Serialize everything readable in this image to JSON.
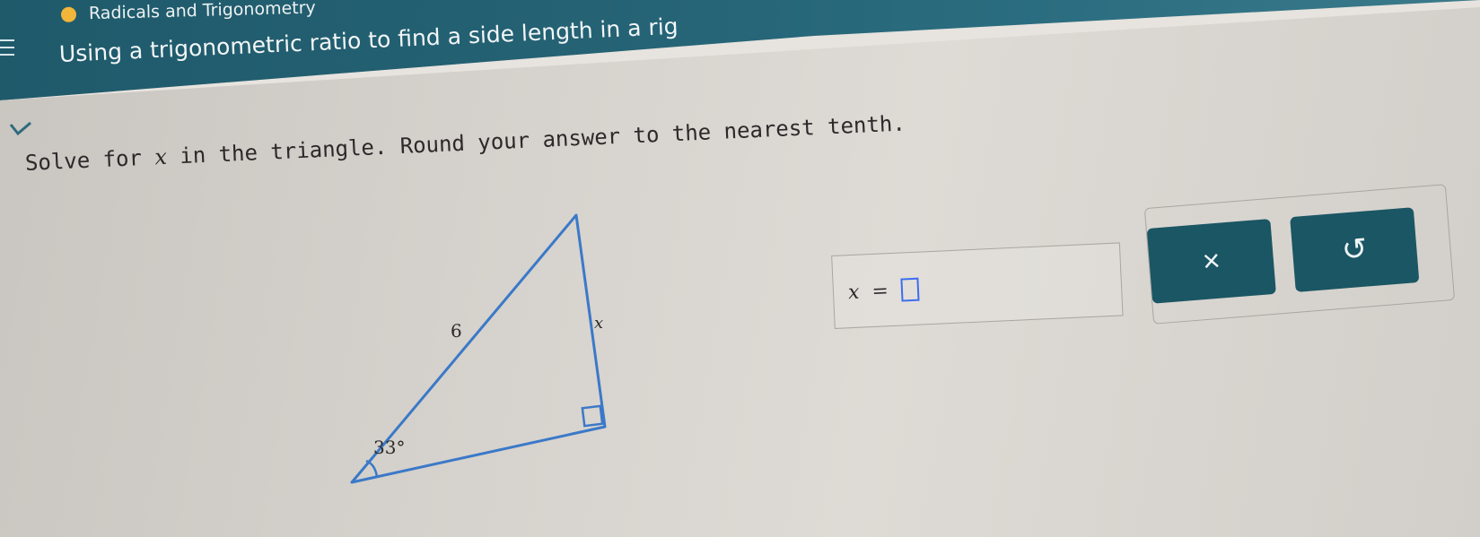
{
  "header": {
    "topic": "Radicals and Trigonometry",
    "lesson_title": "Using a trigonometric ratio to find a side length in a rig"
  },
  "question": {
    "prompt_before": "Solve for ",
    "prompt_var": "x",
    "prompt_after": " in the triangle. Round your answer to the nearest tenth."
  },
  "triangle": {
    "hypotenuse_label": "6",
    "side_label": "x",
    "angle_label": "33°"
  },
  "answer": {
    "variable": "x",
    "equals": "=",
    "value": ""
  },
  "buttons": {
    "clear_symbol": "×",
    "undo_symbol": "↺"
  },
  "colors": {
    "header_band": "#246274",
    "topic_dot": "#f2b63a",
    "button_bg": "#1b5664",
    "triangle_stroke": "#3a79c8",
    "input_border": "#3b6df0"
  },
  "icons": {
    "menu": "hamburger-icon",
    "collapse": "chevron-down-icon",
    "clear": "close-icon",
    "undo": "undo-icon"
  }
}
